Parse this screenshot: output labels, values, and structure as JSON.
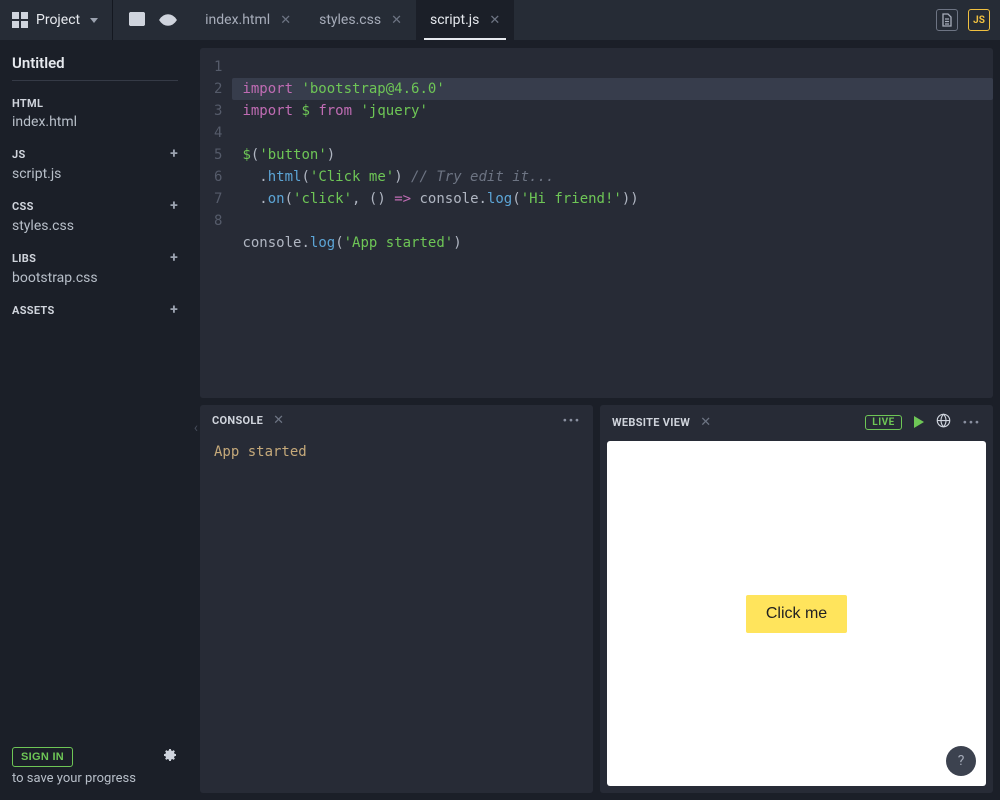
{
  "project": {
    "menu_label": "Project",
    "title": "Untitled"
  },
  "tabs": [
    {
      "label": "index.html",
      "active": false
    },
    {
      "label": "styles.css",
      "active": false
    },
    {
      "label": "script.js",
      "active": true
    }
  ],
  "right_file_icons": {
    "doc": "≣",
    "js": "JS"
  },
  "sidebar": {
    "groups": [
      {
        "label": "HTML",
        "add": false,
        "items": [
          "index.html"
        ]
      },
      {
        "label": "JS",
        "add": true,
        "items": [
          "script.js"
        ]
      },
      {
        "label": "CSS",
        "add": true,
        "items": [
          "styles.css"
        ]
      },
      {
        "label": "LIBS",
        "add": true,
        "items": [
          "bootstrap.css"
        ]
      },
      {
        "label": "ASSETS",
        "add": true,
        "items": []
      }
    ],
    "signin": "SIGN IN",
    "save_text": "to save your progress"
  },
  "editor": {
    "lines": [
      "1",
      "2",
      "3",
      "4",
      "5",
      "6",
      "7",
      "8"
    ],
    "code": {
      "l1": {
        "kw1": "import",
        "str": "'bootstrap@4.6.0'"
      },
      "l2": {
        "kw1": "import",
        "sym": "$",
        "kw2": "from",
        "str": "'jquery'"
      },
      "l4": {
        "sym": "$",
        "p1": "(",
        "str": "'button'",
        "p2": ")"
      },
      "l5": {
        "dot": "  .",
        "m": "html",
        "p1": "(",
        "str": "'Click me'",
        "p2": ") ",
        "cm": "// Try edit it..."
      },
      "l6": {
        "dot": "  .",
        "m": "on",
        "p1": "(",
        "str1": "'click'",
        "c": ", () ",
        "ar": "=>",
        "sp": " ",
        "obj": "console",
        "d2": ".",
        "m2": "log",
        "p2": "(",
        "str2": "'Hi friend!'",
        "p3": "))"
      },
      "l8": {
        "obj": "console",
        "dot": ".",
        "m": "log",
        "p1": "(",
        "str": "'App started'",
        "p2": ")"
      }
    }
  },
  "console": {
    "title": "CONSOLE",
    "output": "App started"
  },
  "webview": {
    "title": "WEBSITE VIEW",
    "live": "LIVE",
    "button": "Click me"
  },
  "help": "?"
}
